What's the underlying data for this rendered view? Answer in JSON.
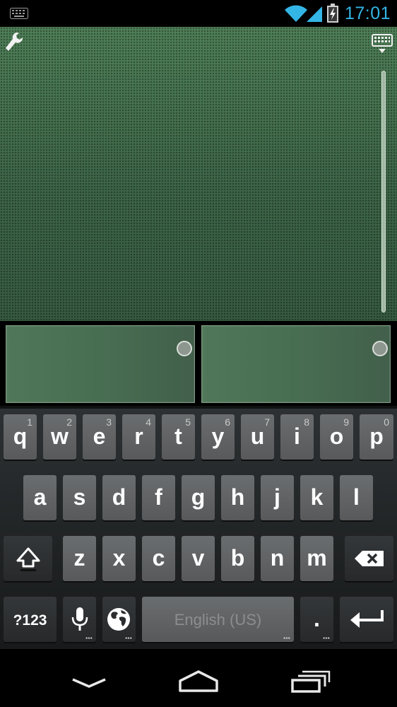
{
  "status_bar": {
    "time": "17:01",
    "left_icon": "keyboard-notification-icon",
    "icons": [
      "wifi-icon",
      "signal-icon",
      "battery-charging-icon"
    ],
    "accent_color": "#33b5e5"
  },
  "touchpad": {
    "icons": [
      "wrench-icon",
      "keyboard-toggle-icon"
    ],
    "background_color": "#3f6b48",
    "buttons": [
      "left-mouse-button",
      "right-mouse-button"
    ]
  },
  "keyboard": {
    "row1": [
      {
        "letter": "q",
        "hint": "1"
      },
      {
        "letter": "w",
        "hint": "2"
      },
      {
        "letter": "e",
        "hint": "3"
      },
      {
        "letter": "r",
        "hint": "4"
      },
      {
        "letter": "t",
        "hint": "5"
      },
      {
        "letter": "y",
        "hint": "6"
      },
      {
        "letter": "u",
        "hint": "7"
      },
      {
        "letter": "i",
        "hint": "8"
      },
      {
        "letter": "o",
        "hint": "9"
      },
      {
        "letter": "p",
        "hint": "0"
      }
    ],
    "row2": [
      "a",
      "s",
      "d",
      "f",
      "g",
      "h",
      "j",
      "k",
      "l"
    ],
    "row3": [
      "z",
      "x",
      "c",
      "v",
      "b",
      "n",
      "m"
    ],
    "symbols_label": "?123",
    "space_label": "English (US)",
    "period_label": ".",
    "icons": [
      "shift-icon",
      "backspace-icon",
      "microphone-icon",
      "globe-icon",
      "enter-icon"
    ]
  },
  "nav_bar": {
    "icons": [
      "back-icon",
      "home-icon",
      "recent-apps-icon"
    ]
  }
}
